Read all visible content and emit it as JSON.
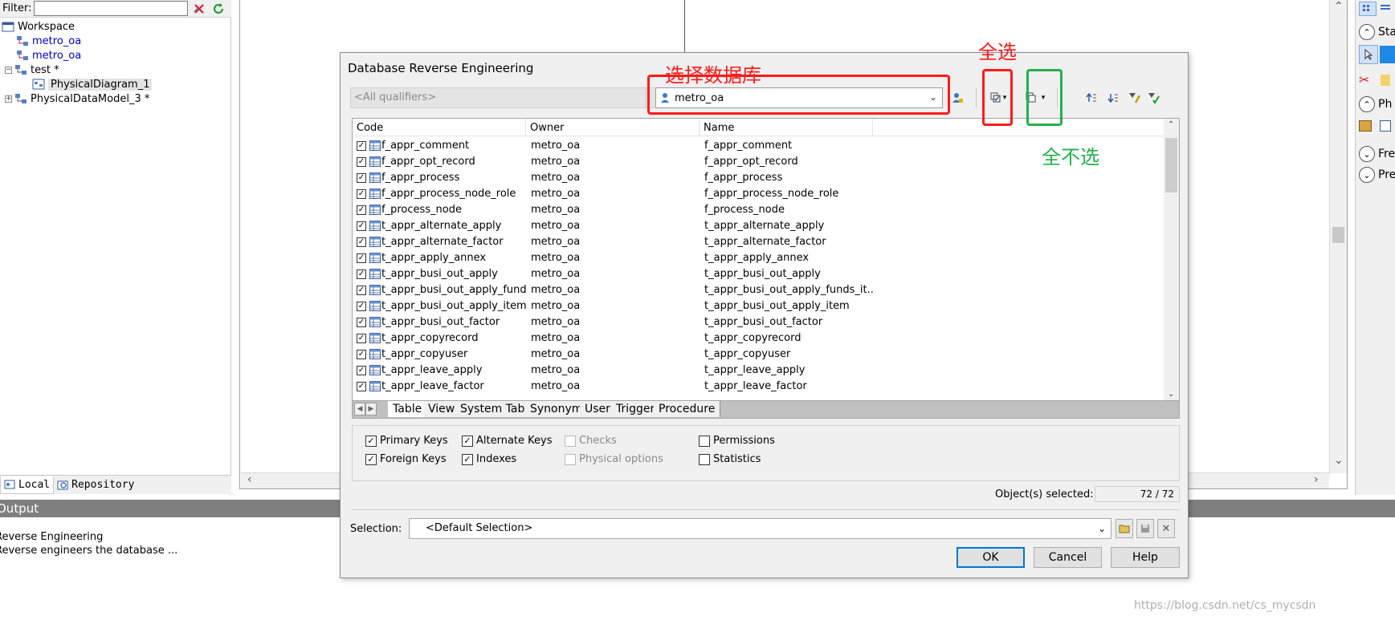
{
  "colors": {
    "annotation_red": "#ff1a1a",
    "annotation_green": "#22b14c",
    "link_blue": "#0000cc",
    "ok_focus": "#0078d7"
  },
  "filter": {
    "label": "Filter:",
    "value": ""
  },
  "tree": {
    "workspace": "Workspace",
    "db1": "metro_oa",
    "db2": "metro_oa",
    "test": "test *",
    "diagram": "PhysicalDiagram_1",
    "model3": "PhysicalDataModel_3 *"
  },
  "left_tabs": {
    "local": "Local",
    "repository": "Repository"
  },
  "right_panel": {
    "r1": "Sta",
    "r2": "Ph",
    "r3": "Fre",
    "r4": "Pre"
  },
  "output": {
    "header": "Output",
    "line1": "Reverse Engineering",
    "line2": "Reverse engineers the database ..."
  },
  "watermark": "https://blog.csdn.net/cs_mycsdn",
  "dialog": {
    "title": "Database Reverse Engineering",
    "qualifier_placeholder": "<All qualifiers>",
    "database": "metro_oa",
    "columns": {
      "code": "Code",
      "owner": "Owner",
      "name": "Name"
    },
    "rows": [
      {
        "code": "f_appr_comment",
        "owner": "metro_oa",
        "name": "f_appr_comment"
      },
      {
        "code": "f_appr_opt_record",
        "owner": "metro_oa",
        "name": "f_appr_opt_record"
      },
      {
        "code": "f_appr_process",
        "owner": "metro_oa",
        "name": "f_appr_process"
      },
      {
        "code": "f_appr_process_node_role",
        "owner": "metro_oa",
        "name": "f_appr_process_node_role"
      },
      {
        "code": "f_process_node",
        "owner": "metro_oa",
        "name": "f_process_node"
      },
      {
        "code": "t_appr_alternate_apply",
        "owner": "metro_oa",
        "name": "t_appr_alternate_apply"
      },
      {
        "code": "t_appr_alternate_factor",
        "owner": "metro_oa",
        "name": "t_appr_alternate_factor"
      },
      {
        "code": "t_appr_apply_annex",
        "owner": "metro_oa",
        "name": "t_appr_apply_annex"
      },
      {
        "code": "t_appr_busi_out_apply",
        "owner": "metro_oa",
        "name": "t_appr_busi_out_apply"
      },
      {
        "code": "t_appr_busi_out_apply_fund...",
        "owner": "metro_oa",
        "name": "t_appr_busi_out_apply_funds_it..."
      },
      {
        "code": "t_appr_busi_out_apply_item",
        "owner": "metro_oa",
        "name": "t_appr_busi_out_apply_item"
      },
      {
        "code": "t_appr_busi_out_factor",
        "owner": "metro_oa",
        "name": "t_appr_busi_out_factor"
      },
      {
        "code": "t_appr_copyrecord",
        "owner": "metro_oa",
        "name": "t_appr_copyrecord"
      },
      {
        "code": "t_appr_copyuser",
        "owner": "metro_oa",
        "name": "t_appr_copyuser"
      },
      {
        "code": "t_appr_leave_apply",
        "owner": "metro_oa",
        "name": "t_appr_leave_apply"
      },
      {
        "code": "t_appr_leave_factor",
        "owner": "metro_oa",
        "name": "t_appr_leave_factor"
      }
    ],
    "tabs": [
      "Table",
      "View",
      "System Table",
      "Synonym",
      "User",
      "Trigger",
      "Procedure"
    ],
    "options": {
      "primary_keys": "Primary Keys",
      "foreign_keys": "Foreign Keys",
      "alternate_keys": "Alternate Keys",
      "indexes": "Indexes",
      "checks": "Checks",
      "physical_options": "Physical options",
      "permissions": "Permissions",
      "statistics": "Statistics"
    },
    "objects_selected_label": "Object(s) selected:",
    "objects_selected_value": "72 / 72",
    "selection_label": "Selection:",
    "selection_value": "<Default Selection>",
    "buttons": {
      "ok": "OK",
      "cancel": "Cancel",
      "help": "Help"
    }
  },
  "annotations": {
    "select_db": "选择数据库",
    "select_all": "全选",
    "deselect_all": "全不选"
  }
}
